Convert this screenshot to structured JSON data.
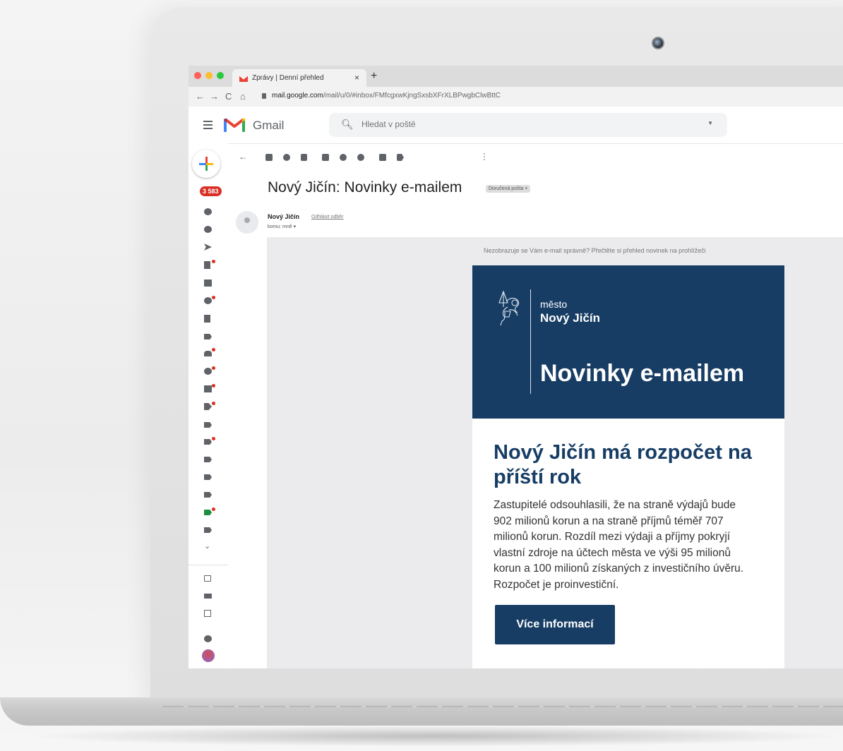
{
  "browser": {
    "tab_title": "Zprávy | Denní přehled",
    "tab_close": "×",
    "new_tab": "+",
    "url_host": "mail.google.com",
    "url_path": "/mail/u/0/#inbox/FMfcgxwKjngSxsbXFrXLBPwgbClwBttC",
    "colors": {
      "close": "#ff5f57",
      "minimize": "#febc2e",
      "maximize": "#28c840"
    }
  },
  "gmail": {
    "app_name": "Gmail",
    "search_placeholder": "Hledat v poště",
    "unread_count": "3 583"
  },
  "message": {
    "subject": "Nový Jičín: Novinky e-mailem",
    "label": "Doručená pošta ×",
    "sender": "Nový Jičín",
    "unsubscribe": "Odhlásit odběr",
    "recipient": "komu: mně ▾"
  },
  "newsletter": {
    "notice": "Nezobrazuje se Vám e-mail správně? Přečtěte si přehled novinek na prohlížeči",
    "city_prefix": "město",
    "city_name": "Nový Jičín",
    "hero_title": "Novinky e-mailem",
    "headline": "Nový Jičín má rozpočet na příští rok",
    "body": "Zastupitelé odsouhlasili, že na straně výdajů bude 902 milionů korun a na straně příjmů téměř 707 milionů korun. Rozdíl mezi výdaji a příjmy pokryjí vlastní zdroje na účtech města ve výši 95 milionů korun a 100 milionů získaných z investičního úvěru. Rozpočet je proinvestiční.",
    "button": "Více informací",
    "brand_color": "#173d65"
  }
}
